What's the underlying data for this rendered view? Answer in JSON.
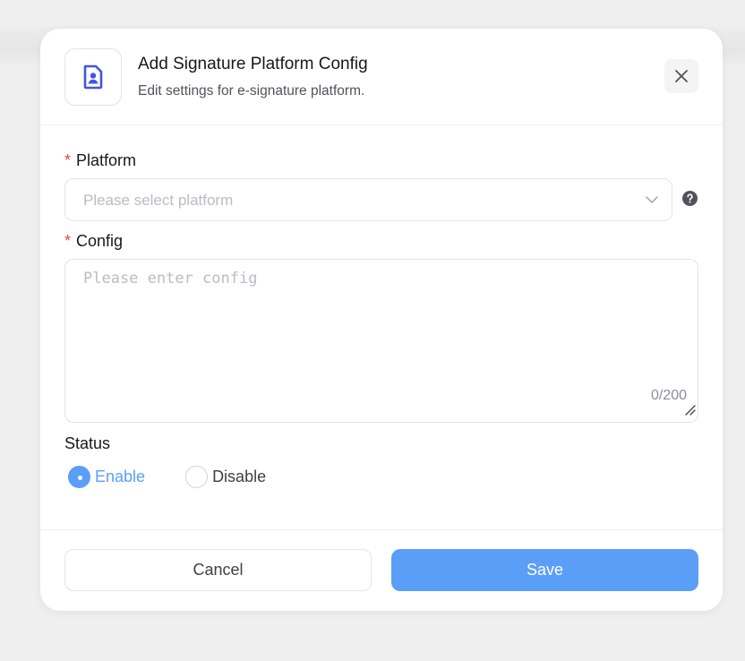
{
  "dialog": {
    "title": "Add Signature Platform Config",
    "subtitle": "Edit settings for e-signature platform.",
    "icon": "user-document-icon",
    "close_icon": "close-icon"
  },
  "form": {
    "platform": {
      "label": "Platform",
      "required_mark": "*",
      "placeholder": "Please select platform",
      "value": ""
    },
    "config": {
      "label": "Config",
      "required_mark": "*",
      "placeholder": "Please enter config",
      "value": "",
      "counter": "0/200"
    },
    "status": {
      "label": "Status",
      "options": [
        {
          "label": "Enable",
          "selected": true
        },
        {
          "label": "Disable",
          "selected": false
        }
      ]
    }
  },
  "footer": {
    "cancel_label": "Cancel",
    "save_label": "Save"
  },
  "colors": {
    "primary": "#5b9ef7",
    "required": "#ef4444",
    "icon_accent": "#4355e0"
  }
}
